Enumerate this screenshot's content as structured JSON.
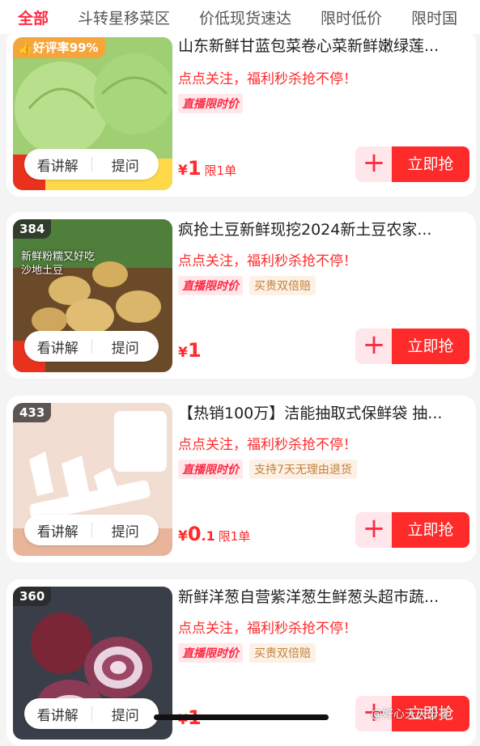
{
  "tabs": [
    "全部",
    "斗转星移菜区",
    "价低现货速达",
    "限时低价",
    "限时国"
  ],
  "products": [
    {
      "title": "山东新鲜甘蓝包菜卷心菜新鲜嫩绿莲...",
      "promo": "点点关注，福利秒杀抢不停！",
      "tag_live": "直播限时价",
      "tag_extra": "",
      "badge": "",
      "good_rate": "好评率99%",
      "price_currency": "¥",
      "price_int": "1",
      "price_dec": "",
      "limit": "限1单",
      "btn_explain": "看讲解",
      "btn_ask": "提问",
      "btn_buy": "立即抢",
      "btn_add": "+",
      "thumb_icon": "cabbage-image"
    },
    {
      "title": "疯抢土豆新鲜现挖2024新土豆农家...",
      "promo": "点点关注，福利秒杀抢不停！",
      "tag_live": "直播限时价",
      "tag_extra": "买贵双倍赔",
      "badge": "384",
      "good_rate": "",
      "price_currency": "¥",
      "price_int": "1",
      "price_dec": "",
      "limit": "",
      "btn_explain": "看讲解",
      "btn_ask": "提问",
      "btn_buy": "立即抢",
      "btn_add": "+",
      "thumb_text": "新鲜粉糯又好吃\n沙地土豆",
      "thumb_icon": "potato-image"
    },
    {
      "title": "【热销100万】洁能抽取式保鲜袋 抽...",
      "promo": "点点关注，福利秒杀抢不停！",
      "tag_live": "直播限时价",
      "tag_extra": "支持7天无理由退货",
      "badge": "433",
      "good_rate": "",
      "price_currency": "¥",
      "price_int": "0",
      "price_dec": ".1",
      "limit": "限1单",
      "btn_explain": "看讲解",
      "btn_ask": "提问",
      "btn_buy": "立即抢",
      "btn_add": "+",
      "thumb_icon": "food-bag-image"
    },
    {
      "title": "新鲜洋葱自营紫洋葱生鲜葱头超市蔬...",
      "promo": "点点关注，福利秒杀抢不停！",
      "tag_live": "直播限时价",
      "tag_extra": "买贵双倍赔",
      "badge": "360",
      "good_rate": "",
      "price_currency": "¥",
      "price_int": "1",
      "price_dec": "",
      "limit": "",
      "btn_explain": "看讲解",
      "btn_ask": "提问",
      "btn_buy": "立即抢",
      "btn_add": "+",
      "thumb_icon": "onion-image"
    }
  ],
  "watermark": "@好心天天分享",
  "colors": {
    "accent": "#ff2a44",
    "buy": "#ff2a2a",
    "badge_bg": "#f5a53a"
  }
}
